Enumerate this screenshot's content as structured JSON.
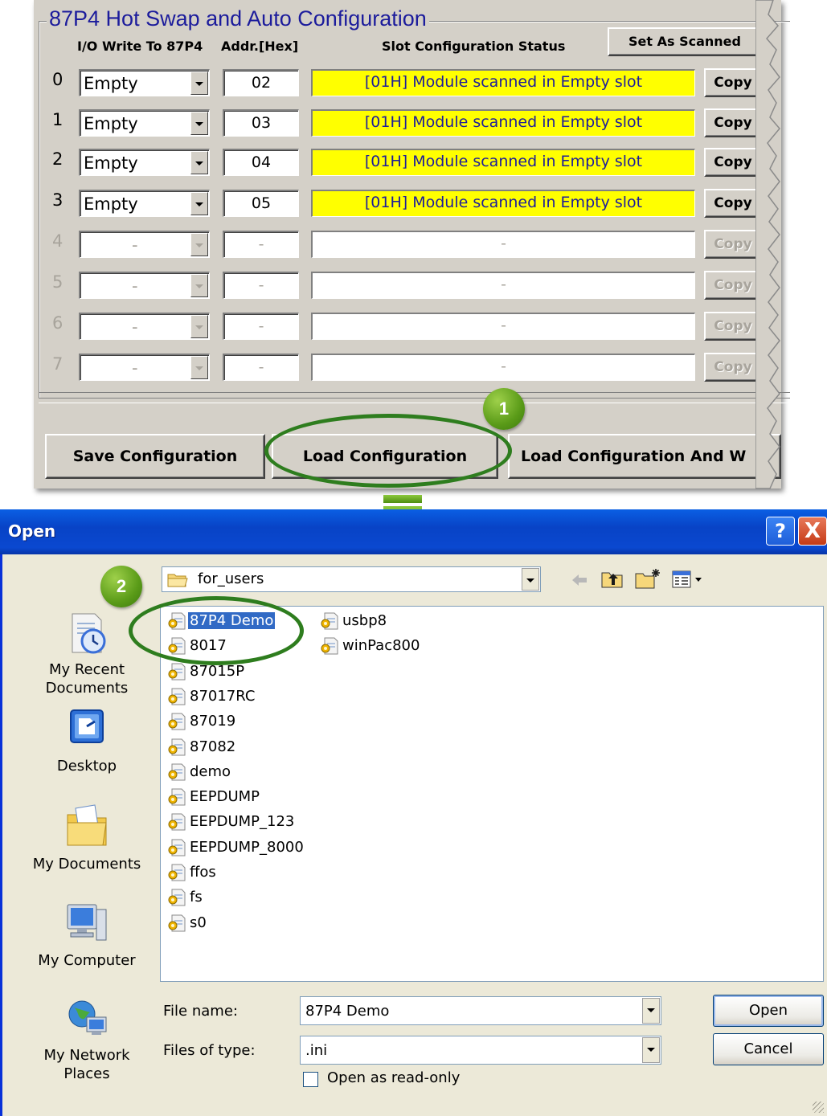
{
  "config_panel": {
    "title": "87P4 Hot Swap and Auto Configuration",
    "columns": {
      "io": "I/O Write To 87P4",
      "addr": "Addr.[Hex]",
      "status": "Slot Configuration Status"
    },
    "set_scanned_label": "Set As Scanned",
    "rows": [
      {
        "slot": "0",
        "module": "Empty",
        "addr": "02",
        "status": "[01H] Module scanned in Empty slot",
        "copy": "Copy"
      },
      {
        "slot": "1",
        "module": "Empty",
        "addr": "03",
        "status": "[01H] Module scanned in Empty slot",
        "copy": "Copy"
      },
      {
        "slot": "2",
        "module": "Empty",
        "addr": "04",
        "status": "[01H] Module scanned in Empty slot",
        "copy": "Copy"
      },
      {
        "slot": "3",
        "module": "Empty",
        "addr": "05",
        "status": "[01H] Module scanned in Empty slot",
        "copy": "Copy"
      },
      {
        "slot": "4",
        "module": "-",
        "addr": "-",
        "status": "-",
        "copy": "Copy"
      },
      {
        "slot": "5",
        "module": "-",
        "addr": "-",
        "status": "-",
        "copy": "Copy"
      },
      {
        "slot": "6",
        "module": "-",
        "addr": "-",
        "status": "-",
        "copy": "Copy"
      },
      {
        "slot": "7",
        "module": "-",
        "addr": "-",
        "status": "-",
        "copy": "Copy"
      }
    ],
    "buttons": {
      "save": "Save Configuration",
      "load": "Load Configuration",
      "load_write": "Load  Configuration And W"
    },
    "status_color": "#ffff00"
  },
  "callouts": {
    "step1": "1",
    "step2": "2",
    "color": "#2e7d1e"
  },
  "open_dialog": {
    "title": "Open",
    "help_glyph": "?",
    "close_glyph": "X",
    "look_in": "for_users",
    "toolbar_icons": [
      "back-icon",
      "up-folder-icon",
      "new-folder-icon",
      "view-menu-icon"
    ],
    "places": [
      "My Recent Documents",
      "Desktop",
      "My Documents",
      "My Computer",
      "My Network Places"
    ],
    "files_col1": [
      "87P4 Demo",
      "8017",
      "87015P",
      "87017RC",
      "87019",
      "87082",
      "demo",
      "EEPDUMP",
      "EEPDUMP_123",
      "EEPDUMP_8000",
      "ffos",
      "fs",
      "s0"
    ],
    "files_col2": [
      "usbp8",
      "winPac800"
    ],
    "selected_file": "87P4 Demo",
    "file_name_label": "File name:",
    "file_name_value": "87P4 Demo",
    "file_type_label": "Files of type:",
    "file_type_value": ".ini",
    "read_only_label": "Open as read-only",
    "open_label": "Open",
    "cancel_label": "Cancel",
    "title_bar_color": "#0a48d0"
  }
}
